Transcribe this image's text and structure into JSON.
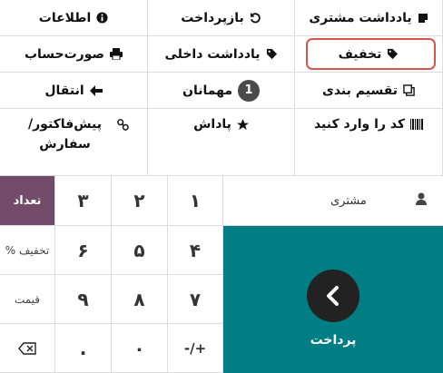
{
  "actions": {
    "customer_note": {
      "label": "یادداشت مشتری",
      "icon": "note-icon"
    },
    "refund": {
      "label": "بازپرداخت",
      "icon": "undo-icon"
    },
    "info": {
      "label": "اطلاعات",
      "icon": "info-icon"
    },
    "discount": {
      "label": "تخفیف",
      "icon": "tag-icon"
    },
    "internal_note": {
      "label": "یادداشت داخلی",
      "icon": "tag-icon"
    },
    "bill": {
      "label": "صورت‌حساب",
      "icon": "printer-icon"
    },
    "split": {
      "label": "تقسیم بندی",
      "icon": "copy-icon"
    },
    "guests": {
      "label": "مهمانان",
      "count": "1"
    },
    "transfer": {
      "label": "انتقال",
      "icon": "arrow-left-icon"
    },
    "enter_code": {
      "label": "کد را وارد کنید",
      "icon": "barcode-icon"
    },
    "reward": {
      "label": "پاداش",
      "icon": "star-icon"
    },
    "quotation_order": {
      "label": "پیش‌فاکتور/سفارش",
      "icon": "link-icon"
    }
  },
  "numpad": {
    "keys": [
      "۱",
      "۲",
      "۳",
      "۴",
      "۵",
      "۶",
      "۷",
      "۸",
      "۹",
      "-/+",
      "۰",
      "."
    ],
    "qty": "تعداد",
    "discount_pct": "% تخفیف",
    "price": "قیمت",
    "backspace_icon": "backspace-icon"
  },
  "customer": {
    "label": "مشتری",
    "icon": "user-icon"
  },
  "payment": {
    "label": "پرداخت",
    "icon": "chevron-right-icon"
  },
  "colors": {
    "accent": "#714b67",
    "payment": "#017e84",
    "highlight": "#d9534f"
  }
}
